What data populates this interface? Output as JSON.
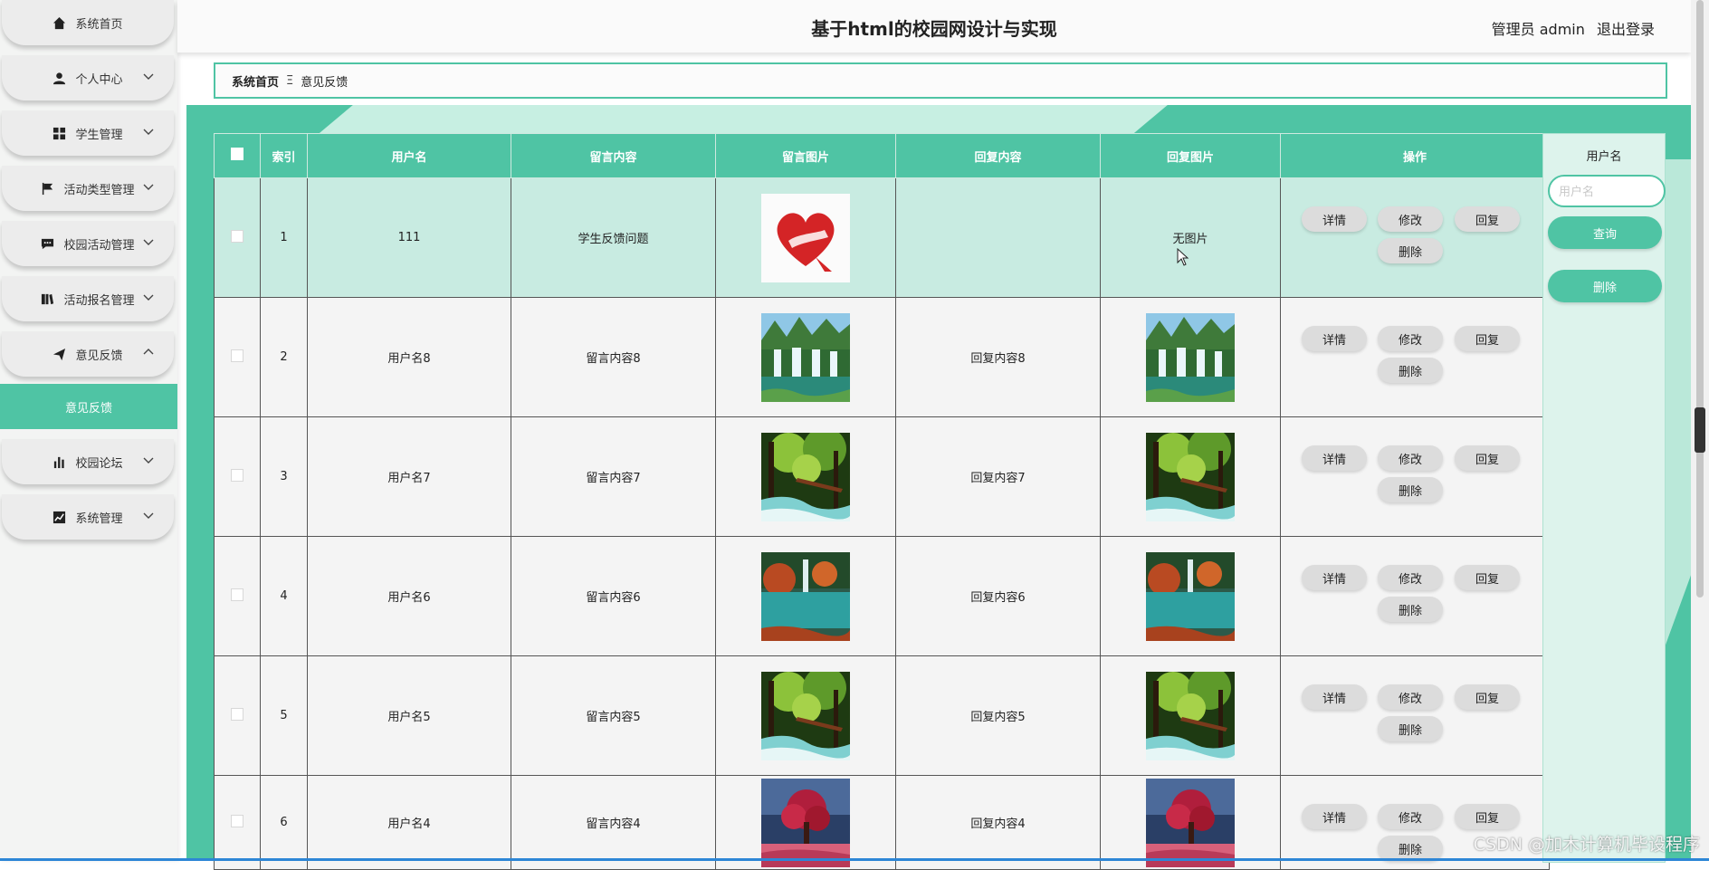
{
  "app": {
    "title": "基于html的校园网设计与实现"
  },
  "header": {
    "user": "管理员 admin",
    "logout": "退出登录"
  },
  "sidebar": {
    "items": [
      {
        "label": "系统首页",
        "icon": "home-icon"
      },
      {
        "label": "个人中心",
        "icon": "user-icon"
      },
      {
        "label": "学生管理",
        "icon": "grid-icon"
      },
      {
        "label": "活动类型管理",
        "icon": "flag-icon"
      },
      {
        "label": "校园活动管理",
        "icon": "chat-icon"
      },
      {
        "label": "活动报名管理",
        "icon": "book-icon"
      },
      {
        "label": "意见反馈",
        "icon": "send-icon"
      },
      {
        "label": "校园论坛",
        "icon": "bar-chart-icon"
      },
      {
        "label": "系统管理",
        "icon": "line-chart-icon"
      }
    ],
    "active_sub": "意见反馈"
  },
  "breadcrumb": {
    "home": "系统首页",
    "sep": "Ξ",
    "current": "意见反馈"
  },
  "table": {
    "headers": [
      "索引",
      "用户名",
      "留言内容",
      "留言图片",
      "回复内容",
      "回复图片",
      "操作"
    ],
    "rows": [
      {
        "index": "1",
        "user": "111",
        "content": "学生反馈问题",
        "reply": "",
        "reply_img_text": "无图片",
        "img": "heart-logo"
      },
      {
        "index": "2",
        "user": "用户名8",
        "content": "留言内容8",
        "reply": "回复内容8",
        "img": "waterfall"
      },
      {
        "index": "3",
        "user": "用户名7",
        "content": "留言内容7",
        "reply": "回复内容7",
        "img": "forest"
      },
      {
        "index": "4",
        "user": "用户名6",
        "content": "留言内容6",
        "reply": "回复内容6",
        "img": "lake"
      },
      {
        "index": "5",
        "user": "用户名5",
        "content": "留言内容5",
        "reply": "回复内容5",
        "img": "forest"
      },
      {
        "index": "6",
        "user": "用户名4",
        "content": "留言内容4",
        "reply": "回复内容4",
        "img": "red-tree"
      }
    ],
    "ops": {
      "detail": "详情",
      "edit": "修改",
      "reply": "回复",
      "delete": "删除"
    }
  },
  "search": {
    "label": "用户名",
    "placeholder": "用户名",
    "query": "查询",
    "delete": "删除"
  },
  "watermark": "CSDN @加木计算机毕设程序",
  "colors": {
    "accent": "#4fc4a4",
    "highlight_row": "#c8ebe1"
  }
}
